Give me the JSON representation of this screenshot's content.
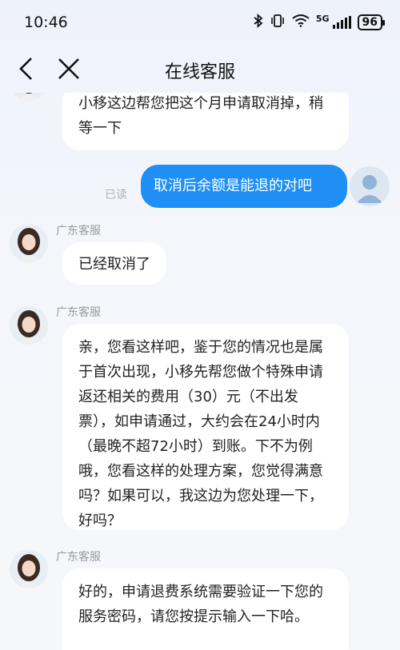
{
  "status_bar": {
    "time": "10:46",
    "network": "5G",
    "battery": "96"
  },
  "header": {
    "title": "在线客服"
  },
  "messages": [
    {
      "from": "agent",
      "name": "",
      "text": "小移这边帮您把这个月申请取消掉，稍等一下"
    },
    {
      "from": "user",
      "read": "已读",
      "text": "取消后余额是能退的对吧"
    },
    {
      "from": "agent",
      "name": "广东客服",
      "text": "已经取消了"
    },
    {
      "from": "agent",
      "name": "广东客服",
      "text": "亲，您看这样吧，鉴于您的情况也是属于首次出现，小移先帮您做个特殊申请返还相关的费用（30）元（不出发票），如申请通过，大约会在24小时内（最晚不超72小时）到账。下不为例哦，您看这样的处理方案，您觉得满意吗？如果可以，我这边为您处理一下，好吗？"
    },
    {
      "from": "agent",
      "name": "广东客服",
      "text": "好的，申请退费系统需要验证一下您的服务密码，请您按提示输入一下哈。"
    }
  ],
  "colors": {
    "user_bubble": "#1f8ff5",
    "agent_bubble": "#ffffff"
  }
}
